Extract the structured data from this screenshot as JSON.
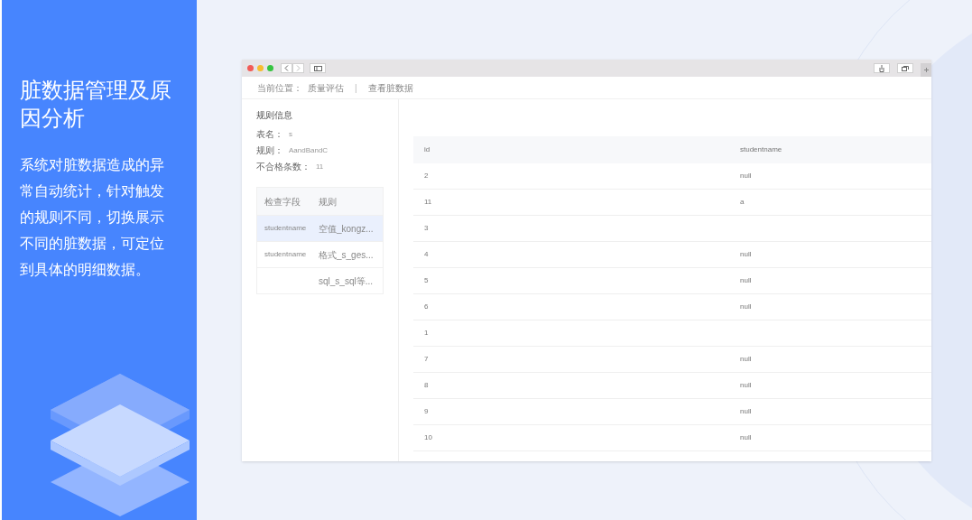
{
  "feature": {
    "title": "脏数据管理及原因分析",
    "description": "系统对脏数据造成的异常自动统计，针对触发的规则不同，切换展示不同的脏数据，可定位到具体的明细数据。"
  },
  "browser": {
    "breadcrumb": {
      "label": "当前位置：",
      "items": [
        "质量评估",
        "查看脏数据"
      ],
      "separator": "|"
    },
    "rule_info": {
      "title": "规则信息",
      "fields": [
        {
          "label": "表名：",
          "value": "s"
        },
        {
          "label": "规则：",
          "value": "AandBandC"
        },
        {
          "label": "不合格条数：",
          "value": "11"
        }
      ]
    },
    "rules_table": {
      "columns": [
        "检查字段",
        "规则"
      ],
      "rows": [
        {
          "field": "studentname",
          "rule": "空值_kongz...",
          "selected": true
        },
        {
          "field": "studentname",
          "rule": "格式_s_ges...",
          "selected": false
        },
        {
          "rule": "sql_s_sql等...",
          "selected": false
        }
      ]
    },
    "data_table": {
      "columns": [
        "id",
        "studentname"
      ],
      "rows": [
        {
          "id": "2",
          "studentname": "null"
        },
        {
          "id": "11",
          "studentname": "a"
        },
        {
          "id": "3"
        },
        {
          "id": "4",
          "studentname": "null"
        },
        {
          "id": "5",
          "studentname": "null"
        },
        {
          "id": "6",
          "studentname": "null"
        },
        {
          "id": "1"
        },
        {
          "id": "7",
          "studentname": "null"
        },
        {
          "id": "8",
          "studentname": "null"
        },
        {
          "id": "9",
          "studentname": "null"
        },
        {
          "id": "10",
          "studentname": "null"
        }
      ]
    }
  }
}
